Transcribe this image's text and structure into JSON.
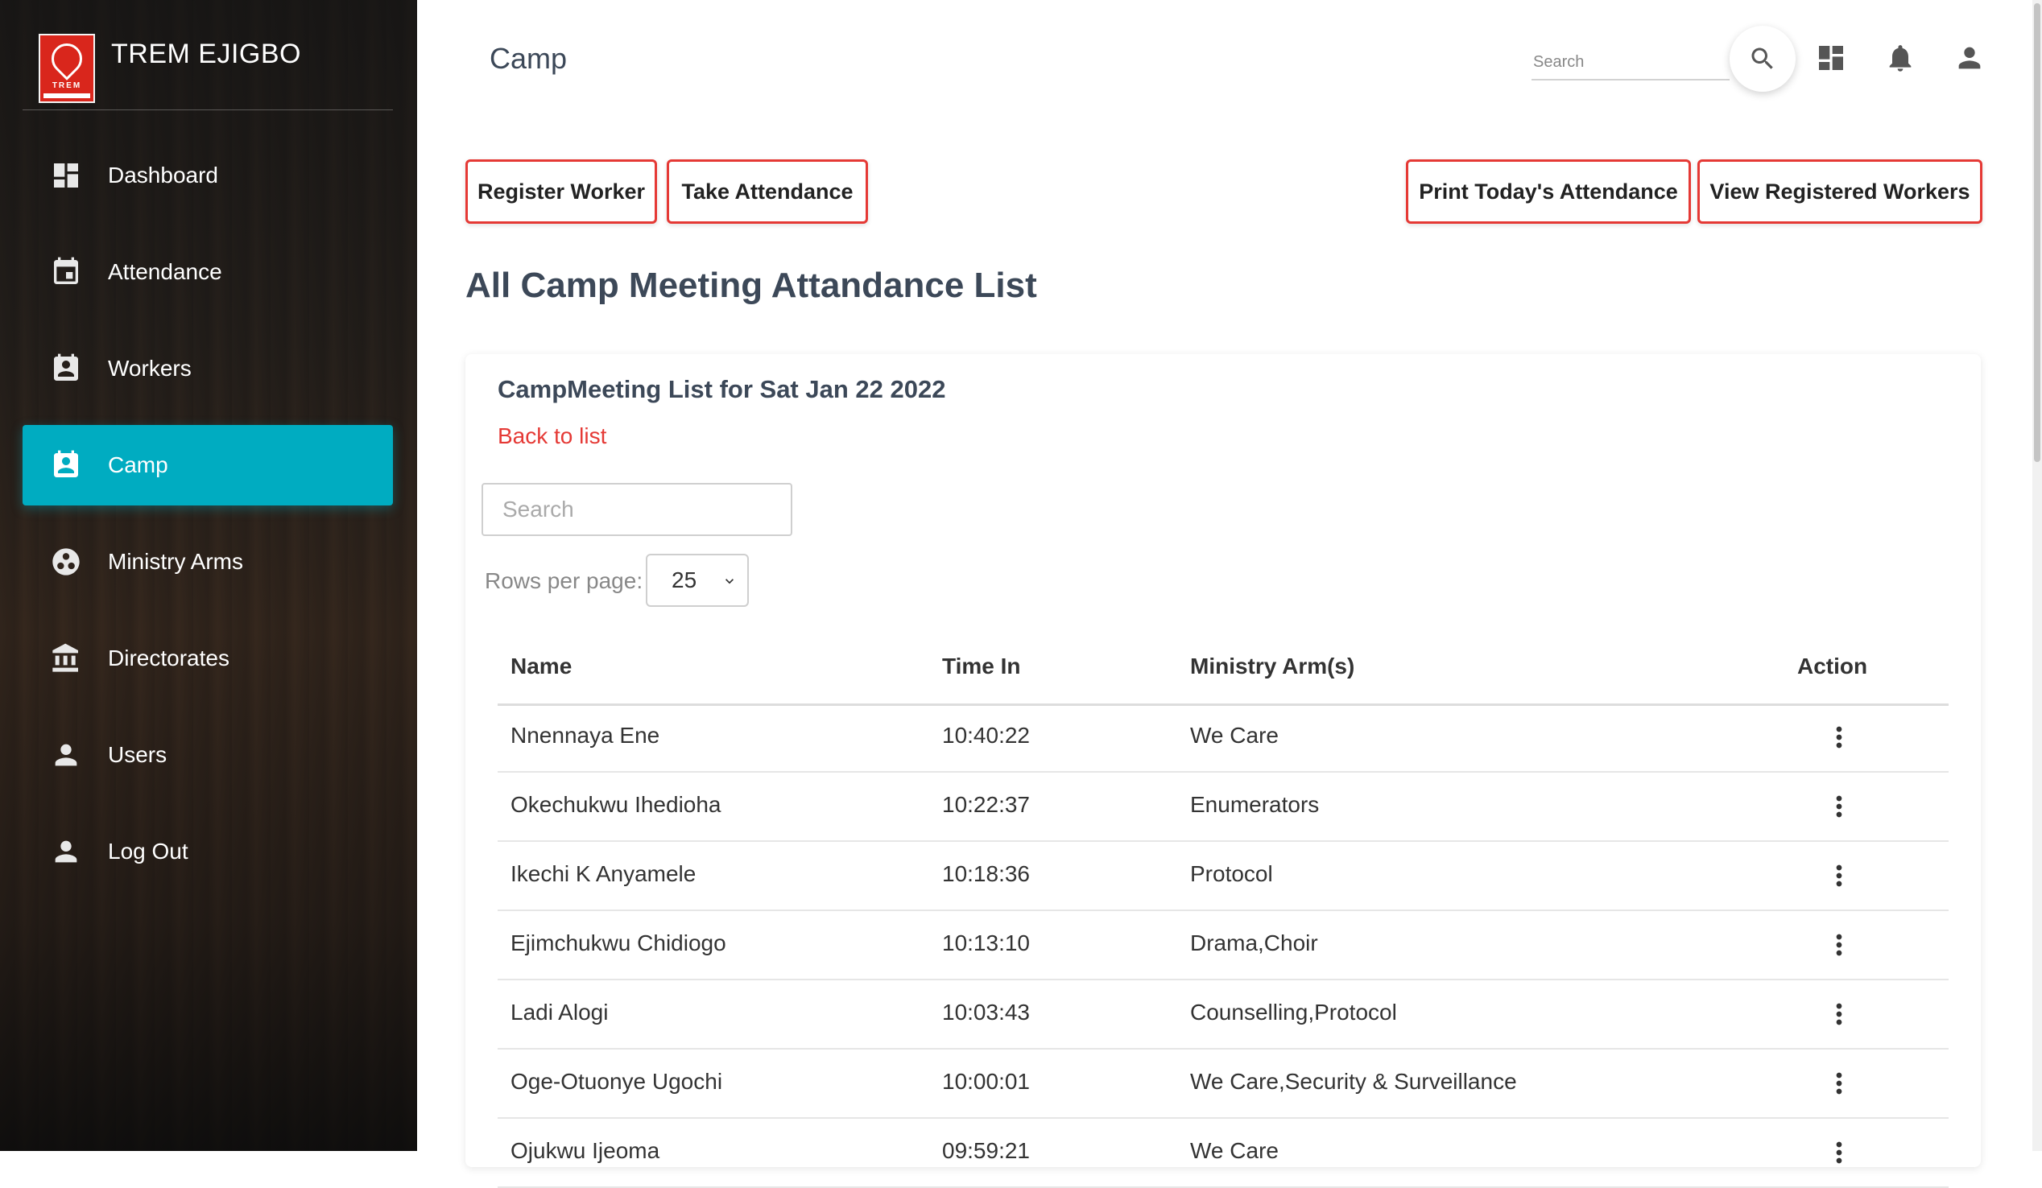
{
  "sidebar": {
    "brand_name": "TREM EJIGBO",
    "logo_text": "TREM",
    "items": [
      {
        "label": "Dashboard",
        "icon": "dashboard-icon"
      },
      {
        "label": "Attendance",
        "icon": "calendar-icon"
      },
      {
        "label": "Workers",
        "icon": "contact-badge-icon"
      },
      {
        "label": "Camp",
        "icon": "contact-badge-icon",
        "active": true
      },
      {
        "label": "Ministry Arms",
        "icon": "group-work-icon"
      },
      {
        "label": "Directorates",
        "icon": "institution-icon"
      },
      {
        "label": "Users",
        "icon": "person-icon"
      },
      {
        "label": "Log Out",
        "icon": "person-icon"
      }
    ],
    "active_color": "#00acc1"
  },
  "header": {
    "title": "Camp",
    "search_placeholder": "Search"
  },
  "actions": {
    "register_worker": "Register Worker",
    "take_attendance": "Take Attendance",
    "print_attendance": "Print Today's Attendance",
    "view_registered": "View Registered Workers",
    "border_color": "#e53935"
  },
  "section_title": "All Camp Meeting Attandance List",
  "card": {
    "title": "CampMeeting List for Sat Jan 22 2022",
    "back_link": "Back to list",
    "search_placeholder": "Search",
    "rows_per_page_label": "Rows per page:",
    "rows_per_page_value": "25"
  },
  "table": {
    "columns": {
      "name": "Name",
      "time_in": "Time In",
      "ministry": "Ministry Arm(s)",
      "action": "Action"
    },
    "rows": [
      {
        "name": "Nnennaya Ene",
        "time_in": "10:40:22",
        "ministry": "We Care"
      },
      {
        "name": "Okechukwu Ihedioha",
        "time_in": "10:22:37",
        "ministry": "Enumerators"
      },
      {
        "name": "Ikechi K Anyamele",
        "time_in": "10:18:36",
        "ministry": "Protocol"
      },
      {
        "name": "Ejimchukwu Chidiogo",
        "time_in": "10:13:10",
        "ministry": "Drama,Choir"
      },
      {
        "name": "Ladi Alogi",
        "time_in": "10:03:43",
        "ministry": "Counselling,Protocol"
      },
      {
        "name": "Oge-Otuonye Ugochi",
        "time_in": "10:00:01",
        "ministry": "We Care,Security & Surveillance"
      },
      {
        "name": "Ojukwu Ijeoma",
        "time_in": "09:59:21",
        "ministry": "We Care"
      }
    ]
  }
}
